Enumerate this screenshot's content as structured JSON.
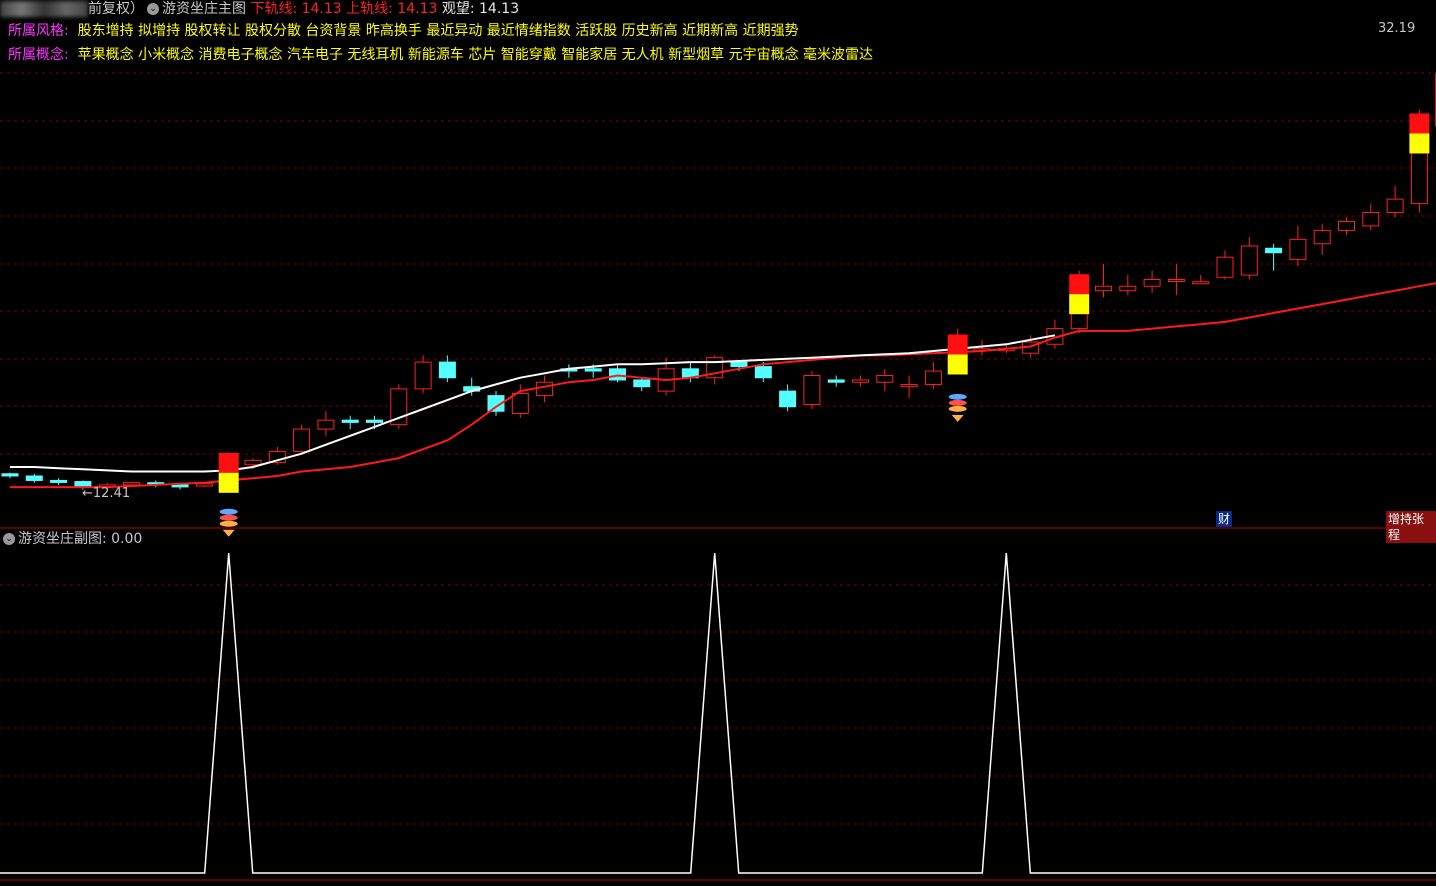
{
  "main_panel": {
    "mode_label": "前复权）",
    "indicator_name": "游资坐庄主图",
    "lower_rail_label": "下轨线: 14.13",
    "upper_rail_label": "上轨线: 14.13",
    "watch_label": "观望: 14.13",
    "style_label": "所属风格:",
    "style_text": "股东增持 拟增持 股权转让 股权分散 台资背景 昨高换手 最近异动 最近情绪指数 活跃股 历史新高 近期新高 近期强势",
    "concept_label": "所属概念:",
    "concept_text": "苹果概念 小米概念 消费电子概念 汽车电子 无线耳机 新能源车 芯片 智能穿戴 智能家居 无人机 新型烟草 元宇宙概念 毫米波雷达",
    "high_price_label": "32.19",
    "low_price_label": "←12.41",
    "finance_badge": "财",
    "event_badge": "增持张程"
  },
  "sub_panel": {
    "indicator_name": "游资坐庄副图",
    "value_label": ": 0.00"
  },
  "colors": {
    "background": "#000000",
    "up_candle": "#ff2020",
    "down_candle": "#54ffff",
    "ma_line": "#ff1a1a",
    "rail_line": "#ffffff",
    "signal_red": "#ff1010",
    "signal_yellow": "#ffff00",
    "grid": "#7a0000"
  },
  "chart_data": {
    "type": "candlestick",
    "price_range": [
      11.5,
      33.0
    ],
    "signal_days": [
      9,
      39,
      44,
      58
    ],
    "candles": [
      [
        12.9,
        12.8,
        12.95,
        12.7
      ],
      [
        12.8,
        12.6,
        12.9,
        12.5
      ],
      [
        12.6,
        12.55,
        12.7,
        12.4
      ],
      [
        12.55,
        12.3,
        12.6,
        12.2
      ],
      [
        12.35,
        12.4,
        12.5,
        12.2
      ],
      [
        12.4,
        12.5,
        12.55,
        12.3
      ],
      [
        12.5,
        12.4,
        12.6,
        12.3
      ],
      [
        12.4,
        12.35,
        12.5,
        12.2
      ],
      [
        12.35,
        12.45,
        12.5,
        12.3
      ],
      [
        12.45,
        13.3,
        13.5,
        12.4
      ],
      [
        13.3,
        13.5,
        13.6,
        13.1
      ],
      [
        13.4,
        13.9,
        14.1,
        13.3
      ],
      [
        13.9,
        14.9,
        15.1,
        13.8
      ],
      [
        14.9,
        15.3,
        15.7,
        14.6
      ],
      [
        15.3,
        15.2,
        15.5,
        14.9
      ],
      [
        15.3,
        15.2,
        15.5,
        14.9
      ],
      [
        15.1,
        16.7,
        16.9,
        14.9
      ],
      [
        16.7,
        17.9,
        18.2,
        16.5
      ],
      [
        17.9,
        17.2,
        18.2,
        17.0
      ],
      [
        16.8,
        16.6,
        17.2,
        16.4
      ],
      [
        16.4,
        15.7,
        16.6,
        15.5
      ],
      [
        15.6,
        16.5,
        16.9,
        15.4
      ],
      [
        16.4,
        17.0,
        17.3,
        16.1
      ],
      [
        17.6,
        17.5,
        17.8,
        17.2
      ],
      [
        17.6,
        17.5,
        17.8,
        17.2
      ],
      [
        17.6,
        17.1,
        17.8,
        17.0
      ],
      [
        17.1,
        16.8,
        17.2,
        16.6
      ],
      [
        16.6,
        17.6,
        18.1,
        16.4
      ],
      [
        17.6,
        17.2,
        17.9,
        17.0
      ],
      [
        17.2,
        18.1,
        18.2,
        16.9
      ],
      [
        17.9,
        17.7,
        18.0,
        17.5
      ],
      [
        17.7,
        17.2,
        17.9,
        17.0
      ],
      [
        16.6,
        15.9,
        16.9,
        15.7
      ],
      [
        16.0,
        17.3,
        17.5,
        15.8
      ],
      [
        17.1,
        17.0,
        17.3,
        16.8
      ],
      [
        17.0,
        17.1,
        17.3,
        16.8
      ],
      [
        17.0,
        17.3,
        17.6,
        16.6
      ],
      [
        16.8,
        16.9,
        17.3,
        16.3
      ],
      [
        16.9,
        17.5,
        17.9,
        16.7
      ],
      [
        17.6,
        18.6,
        19.4,
        17.4
      ],
      [
        18.5,
        18.5,
        18.9,
        18.2
      ],
      [
        18.5,
        18.5,
        18.7,
        18.3
      ],
      [
        18.3,
        18.8,
        19.1,
        18.1
      ],
      [
        18.7,
        19.4,
        19.8,
        18.5
      ],
      [
        19.4,
        21.3,
        22.0,
        19.2
      ],
      [
        21.1,
        21.3,
        22.3,
        20.8
      ],
      [
        21.1,
        21.3,
        21.8,
        20.9
      ],
      [
        21.3,
        21.6,
        22.0,
        21.0
      ],
      [
        21.6,
        21.6,
        22.3,
        20.9
      ],
      [
        21.5,
        21.5,
        21.8,
        21.4
      ],
      [
        21.7,
        22.6,
        22.9,
        21.6
      ],
      [
        21.8,
        23.1,
        23.5,
        21.6
      ],
      [
        23.0,
        22.8,
        23.2,
        22.0
      ],
      [
        22.5,
        23.4,
        24.0,
        22.2
      ],
      [
        23.2,
        23.8,
        24.1,
        22.7
      ],
      [
        23.8,
        24.2,
        24.4,
        23.6
      ],
      [
        24.0,
        24.6,
        25.0,
        23.8
      ],
      [
        24.6,
        25.2,
        25.8,
        24.4
      ],
      [
        25.0,
        28.5,
        29.2,
        24.6
      ],
      [
        28.5,
        30.8,
        32.2,
        27.8
      ]
    ],
    "ma_line": [
      12.3,
      12.3,
      12.3,
      12.3,
      12.3,
      12.35,
      12.4,
      12.45,
      12.5,
      12.6,
      12.7,
      12.8,
      13.0,
      13.1,
      13.2,
      13.4,
      13.6,
      14.0,
      14.4,
      15.1,
      15.9,
      16.6,
      16.8,
      17.0,
      17.1,
      17.3,
      17.2,
      17.1,
      17.2,
      17.4,
      17.6,
      17.8,
      17.9,
      18.0,
      18.1,
      18.2,
      18.2,
      18.25,
      18.3,
      18.35,
      18.4,
      18.5,
      18.6,
      19.0,
      19.3,
      19.3,
      19.3,
      19.4,
      19.5,
      19.6,
      19.7,
      19.9,
      20.1,
      20.3,
      20.5,
      20.7,
      20.9,
      21.1,
      21.3,
      21.5,
      21.4,
      21.3
    ],
    "rail_line": [
      13.2,
      13.2,
      13.15,
      13.1,
      13.05,
      13.0,
      13.0,
      13.0,
      13.0,
      13.05,
      13.2,
      13.5,
      13.8,
      14.2,
      14.6,
      15.0,
      15.4,
      15.8,
      16.2,
      16.6,
      16.9,
      17.2,
      17.4,
      17.6,
      17.7,
      17.8,
      17.8,
      17.85,
      17.9,
      17.9,
      17.95,
      18.0,
      18.05,
      18.1,
      18.15,
      18.2,
      18.25,
      18.3,
      18.4,
      18.5,
      18.6,
      18.7,
      18.9,
      19.1
    ],
    "sub_signal": {
      "range": [
        0,
        1
      ],
      "peaks": [
        {
          "day": 9,
          "value": 1
        },
        {
          "day": 29,
          "value": 1
        },
        {
          "day": 41,
          "value": 1
        }
      ]
    }
  }
}
